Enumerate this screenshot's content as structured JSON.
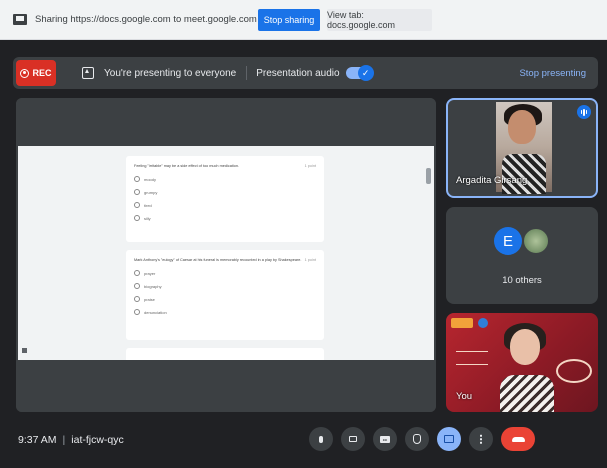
{
  "sharing_bar": {
    "text": "Sharing https://docs.google.com to meet.google.com",
    "stop_sharing_label": "Stop sharing",
    "view_tab_label": "View tab: docs.google.com"
  },
  "presenting_bar": {
    "rec_label": "REC",
    "presenting_text": "You're presenting to everyone",
    "audio_label": "Presentation audio",
    "audio_enabled": true,
    "stop_presenting_label": "Stop presenting"
  },
  "document": {
    "cards": [
      {
        "question": "Feeling \"irritable\" may be a side effect of too much medication.",
        "points": "1 point",
        "options": [
          "moody",
          "grumpy",
          "tired",
          "silly"
        ]
      },
      {
        "question": "Mark Anthony's \"eulogy\" of Caesar at his funeral is memorably recounted in a play by Shakespeare.",
        "points": "1 point",
        "options": [
          "prayer",
          "biography",
          "praise",
          "denunciation"
        ]
      }
    ]
  },
  "participants": {
    "speaker_name": "Argadita Girsang",
    "others_avatar_letter": "E",
    "others_label": "10 others",
    "self_label": "You"
  },
  "bottom_bar": {
    "time": "9:37 AM",
    "meeting_code": "iat-fjcw-qyc"
  },
  "colors": {
    "accent": "#1a73e8",
    "rec": "#d93025",
    "hangup": "#ea4335",
    "active_control": "#8ab4f8"
  }
}
